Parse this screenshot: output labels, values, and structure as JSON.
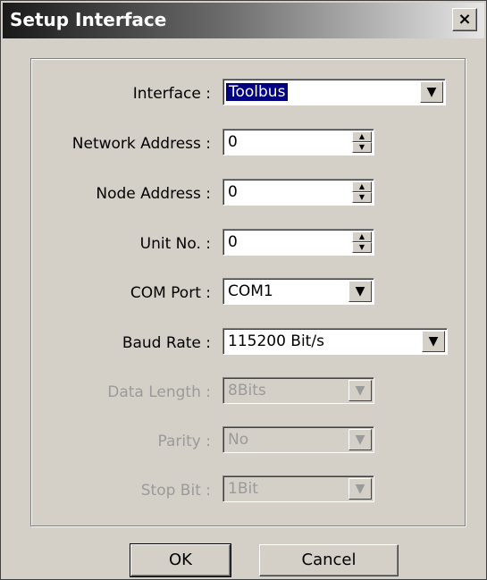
{
  "window": {
    "title": "Setup Interface",
    "close_label": "×"
  },
  "fields": {
    "interface": {
      "label": "Interface :",
      "value": "Toolbus"
    },
    "network_address": {
      "label": "Network Address :",
      "value": "0"
    },
    "node_address": {
      "label": "Node Address :",
      "value": "0"
    },
    "unit_no": {
      "label": "Unit No. :",
      "value": "0"
    },
    "com_port": {
      "label": "COM Port :",
      "value": "COM1"
    },
    "baud_rate": {
      "label": "Baud Rate :",
      "value": "115200 Bit/s"
    },
    "data_length": {
      "label": "Data Length :",
      "value": "8Bits"
    },
    "parity": {
      "label": "Parity :",
      "value": "No"
    },
    "stop_bit": {
      "label": "Stop Bit :",
      "value": "1Bit"
    }
  },
  "buttons": {
    "ok": "OK",
    "cancel": "Cancel"
  },
  "icons": {
    "dropdown": "chevron-down-icon",
    "spin_up": "arrow-up-icon",
    "spin_down": "arrow-down-icon"
  },
  "colors": {
    "selection": "#000080",
    "disabled_text": "#9a9a9a",
    "face": "#d4d0c8"
  }
}
